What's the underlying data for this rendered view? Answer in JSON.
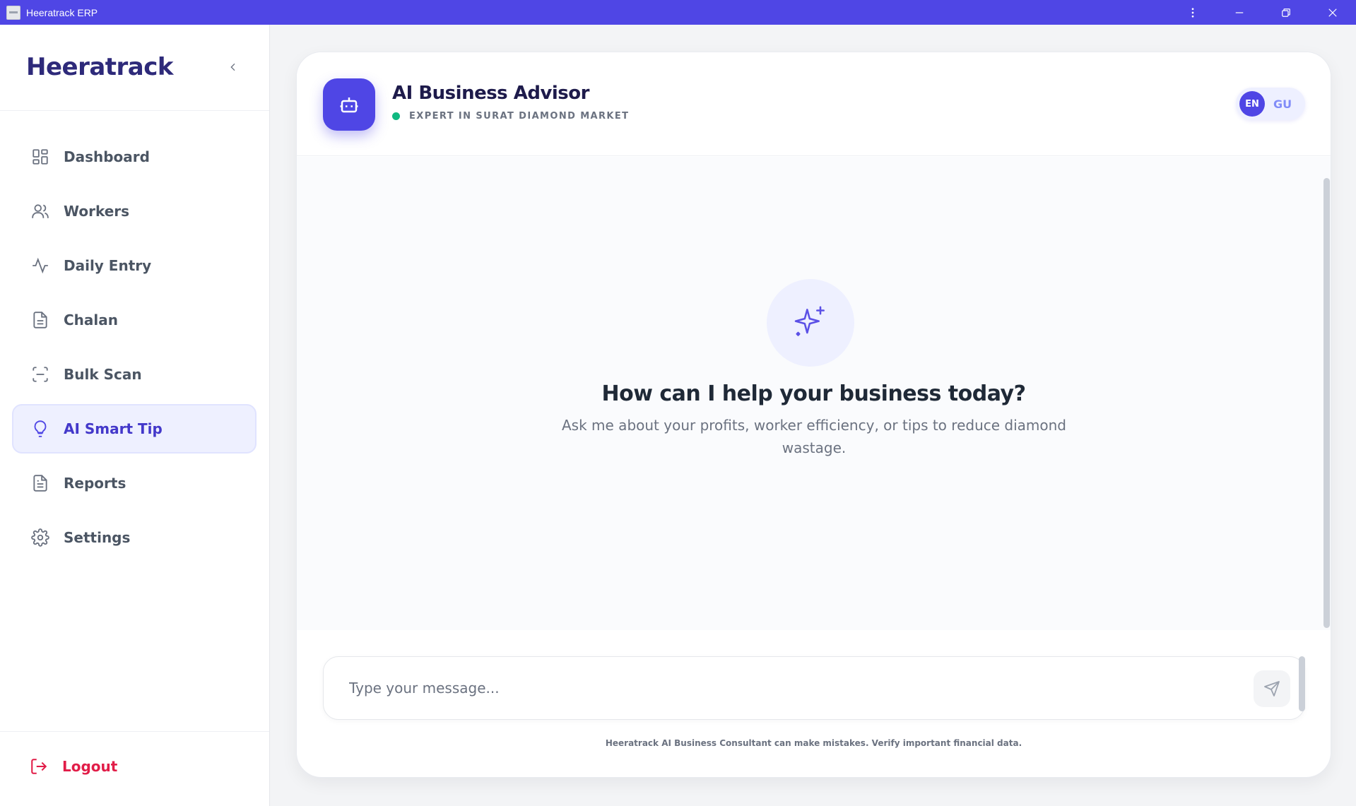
{
  "window": {
    "title": "Heeratrack ERP",
    "controls": [
      "more-icon",
      "minimize-icon",
      "restore-icon",
      "close-icon"
    ]
  },
  "sidebar": {
    "brand": "Heeratrack",
    "items": [
      {
        "label": "Dashboard",
        "icon": "dashboard-grid-icon",
        "active": false
      },
      {
        "label": "Workers",
        "icon": "users-icon",
        "active": false
      },
      {
        "label": "Daily Entry",
        "icon": "activity-icon",
        "active": false
      },
      {
        "label": "Chalan",
        "icon": "document-icon",
        "active": false
      },
      {
        "label": "Bulk Scan",
        "icon": "scan-icon",
        "active": false
      },
      {
        "label": "AI Smart Tip",
        "icon": "lightbulb-icon",
        "active": true
      },
      {
        "label": "Reports",
        "icon": "report-icon",
        "active": false
      },
      {
        "label": "Settings",
        "icon": "gear-icon",
        "active": false
      }
    ],
    "logout_label": "Logout"
  },
  "advisor": {
    "title": "AI Business Advisor",
    "status": "EXPERT IN SURAT DIAMOND MARKET",
    "status_color": "#10b981",
    "languages": {
      "active": "EN",
      "other": "GU"
    }
  },
  "chat": {
    "welcome_title": "How can I help your business today?",
    "welcome_subtitle": "Ask me about your profits, worker efficiency, or tips to reduce diamond wastage.",
    "input_placeholder": "Type your message...",
    "input_value": "",
    "disclaimer": "Heeratrack AI Business Consultant can make mistakes. Verify important financial data."
  },
  "colors": {
    "accent": "#4f46e5",
    "titlebar": "#4f46e5",
    "logout": "#e11d48"
  }
}
